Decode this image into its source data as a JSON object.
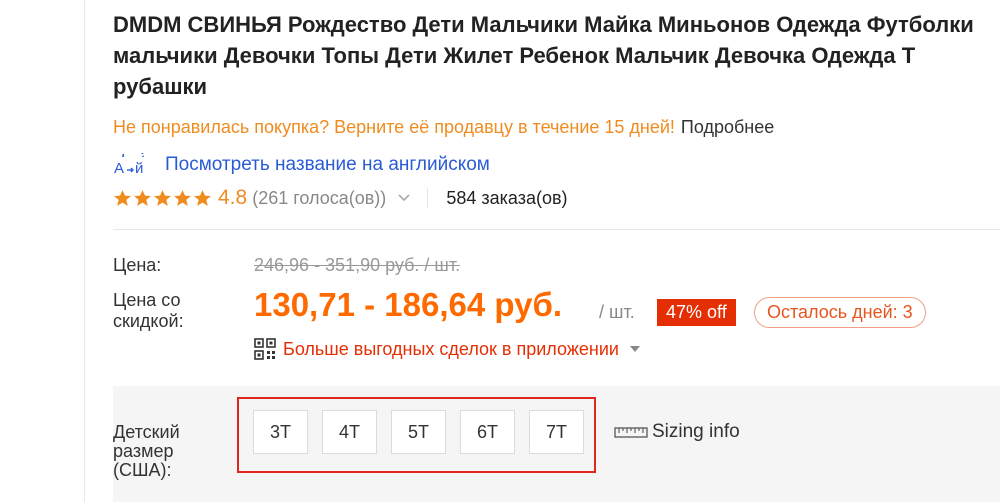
{
  "product": {
    "title": "DMDM СВИНЬЯ Рождество Дети Мальчики Майка Миньонов Одежда Футболки мальчики Девочки Топы Дети Жилет Ребенок Мальчик Девочка Одежда Т рубашки",
    "return_notice": "Не понравилась покупка? Верните её продавцу в течение 15 дней!",
    "return_more": "Подробнее",
    "translate_link": "Посмотреть название на английском",
    "translate_icon": "translate-icon"
  },
  "rating": {
    "stars": 5,
    "score": "4.8",
    "votes": "(261 голоса(ов))",
    "orders": "584 заказа(ов)"
  },
  "price": {
    "label": "Цена:",
    "original": "246,96 - 351,90 руб. / шт.",
    "discount_label": "Цена со скидкой:",
    "current": "130,71 - 186,64 руб.",
    "unit": "/ шт.",
    "discount_badge": "47% off",
    "days_left": "Осталось дней: 3"
  },
  "app_deals": {
    "text": "Больше выгодных сделок в приложении"
  },
  "size_selector": {
    "label": "Детский размер (США):",
    "options": [
      "3T",
      "4T",
      "5T",
      "6T",
      "7T"
    ],
    "sizing_info": "Sizing info"
  },
  "colors": {
    "accent": "#ff6a00",
    "rating": "#f08c1f",
    "link": "#2a5bd7",
    "sale_red": "#e62e04",
    "highlight_box": "#e0271b"
  }
}
